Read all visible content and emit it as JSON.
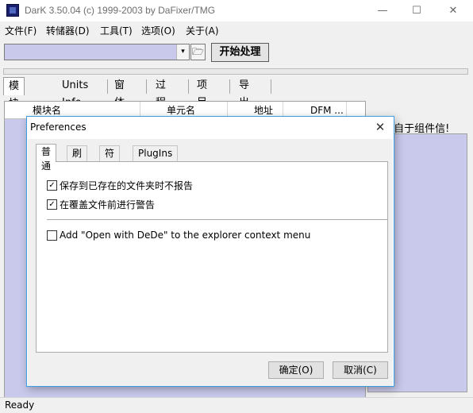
{
  "window": {
    "title": "DarK 3.50.04 (c) 1999-2003 by DaFixer/TMG",
    "controls": {
      "minimize": "—",
      "maximize": "☐",
      "close": "✕"
    }
  },
  "menu": [
    {
      "label": "文件(F)"
    },
    {
      "label": "转储器(D)"
    },
    {
      "label": "工具(T)"
    },
    {
      "label": "选项(O)"
    },
    {
      "label": "关于(A)"
    }
  ],
  "toolbar": {
    "combo_value": "",
    "combo_arrow": "▾",
    "open_icon": "🗁",
    "start_label": "开始处理"
  },
  "main_tabs": [
    {
      "label": "模块信息",
      "active": true
    },
    {
      "label": "Units Info"
    },
    {
      "label": "窗体"
    },
    {
      "label": "过程"
    },
    {
      "label": "项目"
    },
    {
      "label": "导出"
    }
  ],
  "grid": {
    "columns": [
      "模块名",
      "单元名",
      "地址",
      "DFM ..."
    ]
  },
  "right_panel": {
    "label": "表(来自于组件信!"
  },
  "status": {
    "text": "Ready"
  },
  "dialog": {
    "title": "Preferences",
    "close": "✕",
    "tabs": [
      {
        "label": "普通",
        "active": true
      },
      {
        "label": "刷新"
      },
      {
        "label": "符号"
      },
      {
        "label": "PlugIns"
      }
    ],
    "options": [
      {
        "label": "保存到已存在的文件夹时不报告",
        "checked": true
      },
      {
        "label": "在覆盖文件前进行警告",
        "checked": true
      },
      {
        "label": "Add \"Open with DeDe\" to the explorer context menu",
        "checked": false
      }
    ],
    "ok_label": "确定(O)",
    "cancel_label": "取消(C)"
  },
  "colors": {
    "list_background": "#c9c9ec",
    "dialog_border": "#3d9fe0"
  }
}
